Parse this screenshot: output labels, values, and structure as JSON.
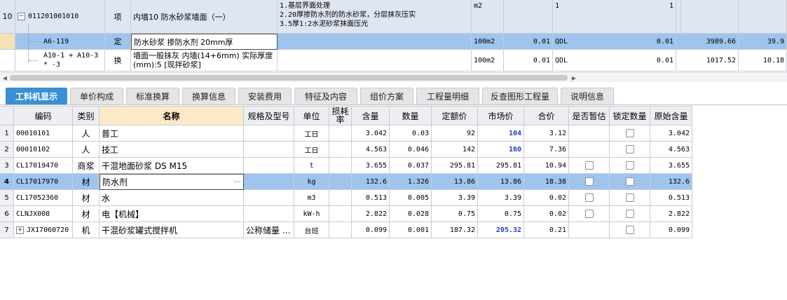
{
  "top_rows": [
    {
      "num": "10",
      "code": "011201001010",
      "type": "项",
      "name": "内墙10 防水砂浆墙面（一）",
      "feature": [
        "1.基层界面处理",
        "2.20厚掺防水剂的防水砂浆，分层抹灰压实",
        "3.5厚1:2水泥砂浆抹面压光"
      ],
      "unit": "m2",
      "qty": "",
      "expr": "1",
      "qty2": "1",
      "price": "",
      "total": ""
    },
    {
      "num": "",
      "code": "A6-119",
      "type": "定",
      "name": "防水砂浆 掺防水剂 20mm厚",
      "feature": [],
      "unit": "100m2",
      "qty": "0.01",
      "expr": "QDL",
      "qty2": "0.01",
      "price": "3989.66",
      "total": "39.9"
    },
    {
      "num": "",
      "code": "A10-1 + A10-3 * -3",
      "type": "换",
      "name": "墙面一般抹灰 内墙(14+6mm)  实际厚度(mm):5  [现拌砂浆]",
      "feature": [],
      "unit": "100m2",
      "qty": "0.01",
      "expr": "QDL",
      "qty2": "0.01",
      "price": "1017.52",
      "total": "10.18"
    }
  ],
  "tabs": [
    "工料机显示",
    "单价构成",
    "标准换算",
    "换算信息",
    "安装费用",
    "特征及内容",
    "组价方案",
    "工程量明细",
    "反查图形工程量",
    "说明信息"
  ],
  "active_tab": 0,
  "columns": [
    "编码",
    "类别",
    "名称",
    "规格及型号",
    "单位",
    "损耗率",
    "含量",
    "数量",
    "定额价",
    "市场价",
    "合价",
    "是否暂估",
    "锁定数量",
    "原始含量"
  ],
  "rows": [
    {
      "n": "1",
      "code": "00010101",
      "cat": "人",
      "name": "普工",
      "spec": "",
      "unit": "工日",
      "loss": "",
      "content": "3.042",
      "qty": "0.03",
      "base": "92",
      "market": "104",
      "total": "3.12",
      "est": false,
      "lock": true,
      "orig": "3.042",
      "hl": true
    },
    {
      "n": "2",
      "code": "00010102",
      "cat": "人",
      "name": "技工",
      "spec": "",
      "unit": "工日",
      "loss": "",
      "content": "4.563",
      "qty": "0.046",
      "base": "142",
      "market": "160",
      "total": "7.36",
      "est": false,
      "lock": true,
      "orig": "4.563",
      "hl": true
    },
    {
      "n": "3",
      "code": "CL17019470",
      "cat": "商浆",
      "name": "干混地面砂浆 DS M15",
      "spec": "",
      "unit": "t",
      "loss": "",
      "content": "3.655",
      "qty": "0.037",
      "base": "295.81",
      "market": "295.81",
      "total": "10.94",
      "est": true,
      "lock": true,
      "orig": "3.655",
      "hl": false
    },
    {
      "n": "4",
      "code": "CL17017970",
      "cat": "材",
      "name": "防水剂",
      "spec": "",
      "unit": "kg",
      "loss": "",
      "content": "132.6",
      "qty": "1.326",
      "base": "13.86",
      "market": "13.86",
      "total": "18.38",
      "est": true,
      "lock": true,
      "orig": "132.6",
      "hl": false
    },
    {
      "n": "5",
      "code": "CL17052360",
      "cat": "材",
      "name": "水",
      "spec": "",
      "unit": "m3",
      "loss": "",
      "content": "0.513",
      "qty": "0.005",
      "base": "3.39",
      "market": "3.39",
      "total": "0.02",
      "est": true,
      "lock": true,
      "orig": "0.513",
      "hl": false
    },
    {
      "n": "6",
      "code": "CLNJX008",
      "cat": "材",
      "name": "电【机械】",
      "spec": "",
      "unit": "kW·h",
      "loss": "",
      "content": "2.822",
      "qty": "0.028",
      "base": "0.75",
      "market": "0.75",
      "total": "0.02",
      "est": true,
      "lock": true,
      "orig": "2.822",
      "hl": false
    },
    {
      "n": "7",
      "code": "JX17060720",
      "cat": "机",
      "name": "干混砂浆罐式搅拌机",
      "spec": "公称储量 …",
      "unit": "台班",
      "loss": "",
      "content": "0.099",
      "qty": "0.001",
      "base": "187.32",
      "market": "205.32",
      "total": "0.21",
      "est": false,
      "lock": true,
      "orig": "0.099",
      "hl": true
    }
  ],
  "selected_row": 3,
  "colors": {
    "accent": "#3a8fd5",
    "selection": "#9fc5ee",
    "market_highlight": "#1f3fbf",
    "header_name": "#fde9c7"
  },
  "icons": {
    "expand": "plus-box-icon",
    "collapse": "minus-box-icon",
    "ellipsis": "ellipsis-icon"
  }
}
